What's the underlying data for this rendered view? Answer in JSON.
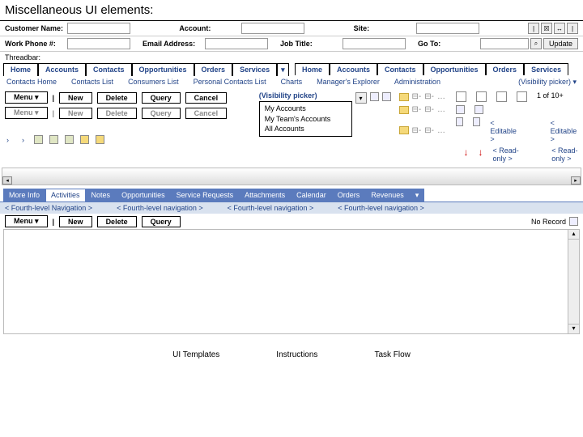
{
  "title": "Miscellaneous UI elements:",
  "fieldrow1": {
    "customer": "Customer Name:",
    "account": "Account:",
    "site": "Site:"
  },
  "fieldrow2": {
    "workphone": "Work Phone #:",
    "email": "Email Address:",
    "jobtitle": "Job Title:",
    "goto": "Go To:",
    "update": "Update"
  },
  "threadbar": "Threadbar:",
  "tabs": [
    "Home",
    "Accounts",
    "Contacts",
    "Opportunities",
    "Orders",
    "Services"
  ],
  "tabs2": [
    "Home",
    "Accounts",
    "Contacts",
    "Opportunities",
    "Orders",
    "Services"
  ],
  "linkrow1": [
    "Contacts Home",
    "Contacts List",
    "Consumers List",
    "Personal Contacts List",
    "Charts",
    "Manager's Explorer",
    "Administration"
  ],
  "linkrow1_r": "(Visibility picker) ▾",
  "tool": {
    "menu": "Menu ▾",
    "new": "New",
    "delete": "Delete",
    "query": "Query",
    "cancel": "Cancel"
  },
  "visibility_label": "(Visibility picker)",
  "visibility_items": [
    "My Accounts",
    "My Team's Accounts",
    "All Accounts"
  ],
  "paging": "1 of 10+",
  "editable": "< Editable >",
  "readonly": "< Read-only >",
  "subtabs": [
    "More Info",
    "Activities",
    "Notes",
    "Opportunities",
    "Service Requests",
    "Attachments",
    "Calendar",
    "Orders",
    "Revenues"
  ],
  "fourthnav": "< Fourth-level navigation >",
  "fourthnav1": "< Fourth-level Navigation >",
  "norecord": "No Record",
  "footer": [
    "UI Templates",
    "Instructions",
    "Task Flow"
  ]
}
